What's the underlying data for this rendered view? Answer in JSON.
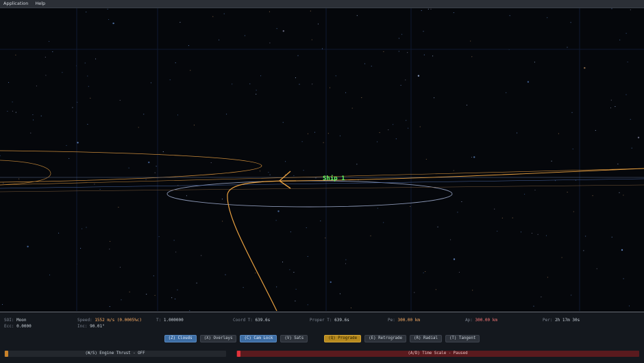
{
  "menu": {
    "application": "Application",
    "help": "Help"
  },
  "scene": {
    "ship_label": "Ship 1"
  },
  "stats": {
    "soi_label": "SOI:",
    "soi_value": "Moon",
    "ecc_label": "Ecc:",
    "ecc_value": "0.0000",
    "speed_label": "Speed:",
    "speed_value": "1552 m/s (0.0005%c)",
    "inc_label": "Inc:",
    "inc_value": "90.01°",
    "t_label": "T:",
    "t_value": "1.000000",
    "coordt_label": "Coord T:",
    "coordt_value": "639.6s",
    "propert_label": "Proper T:",
    "propert_value": "639.6s",
    "pe_label": "Pe:",
    "pe_value": "300.00 km",
    "ap_label": "Ap:",
    "ap_value": "300.00 km",
    "per_label": "Per:",
    "per_value": "2h 17m 30s"
  },
  "buttons": {
    "clouds": "(Z) Clouds",
    "overlays": "(X) Overlays",
    "camlock": "(C) Cam Lock",
    "sats": "(V) Sats",
    "prograde": "(Q) Prograde",
    "retrograde": "(E) Retrograde",
    "radial": "(R) Radial",
    "tangent": "(T) Tangent"
  },
  "controls": {
    "thrust_text": "(W/S)  Engine Thrust  -  OFF",
    "thrust_level": 0,
    "timescale_text": "(A/D)  Time Scale  -  Paused",
    "timescale_level": 0
  },
  "colors": {
    "accent_blue": "#3d6da3",
    "accent_yellow": "#b78a1f",
    "orbit_orange": "#e8a040",
    "ship_green": "#66ff66",
    "time_red": "#e0343c"
  }
}
